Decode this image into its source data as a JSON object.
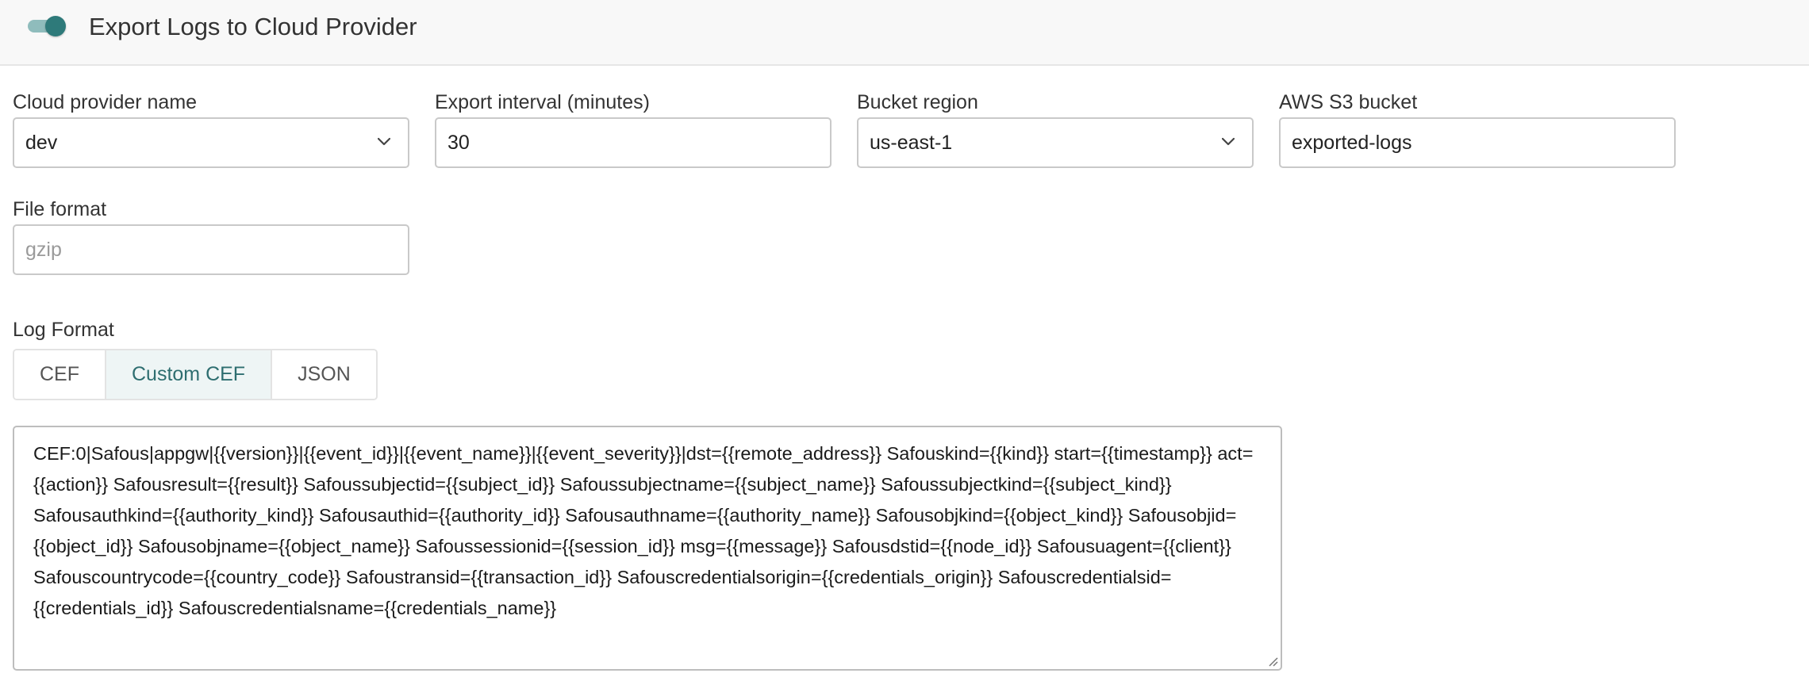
{
  "header": {
    "toggle_on": true,
    "title": "Export Logs to Cloud Provider"
  },
  "form": {
    "cloud_provider": {
      "label": "Cloud provider name",
      "value": "dev"
    },
    "export_interval": {
      "label": "Export interval (minutes)",
      "value": "30"
    },
    "bucket_region": {
      "label": "Bucket region",
      "value": "us-east-1"
    },
    "s3_bucket": {
      "label": "AWS S3 bucket",
      "value": "exported-logs"
    },
    "file_format": {
      "label": "File format",
      "placeholder": "gzip"
    }
  },
  "log_format": {
    "label": "Log Format",
    "options": [
      "CEF",
      "Custom CEF",
      "JSON"
    ],
    "selected": "Custom CEF"
  },
  "template": {
    "text": "CEF:0|Safous|appgw|{{version}}|{{event_id}}|{{event_name}}|{{event_severity}}|dst={{remote_address}} Safouskind={{kind}} start={{timestamp}} act={{action}} Safousresult={{result}} Safoussubjectid={{subject_id}} Safoussubjectname={{subject_name}} Safoussubjectkind={{subject_kind}} Safousauthkind={{authority_kind}} Safousauthid={{authority_id}} Safousauthname={{authority_name}} Safousobjkind={{object_kind}} Safousobjid={{object_id}} Safousobjname={{object_name}} Safoussessionid={{session_id}} msg={{message}} Safousdstid={{node_id}} Safousuagent={{client}} Safouscountrycode={{country_code}} Safoustransid={{transaction_id}} Safouscredentialsorigin={{credentials_origin}} Safouscredentialsid={{credentials_id}} Safouscredentialsname={{credentials_name}}"
  },
  "colors": {
    "accent": "#2e7a7a",
    "toggle_track": "#8fbcbc",
    "segment_active_bg": "#eef5f5",
    "segment_active_text": "#2e6e70"
  }
}
